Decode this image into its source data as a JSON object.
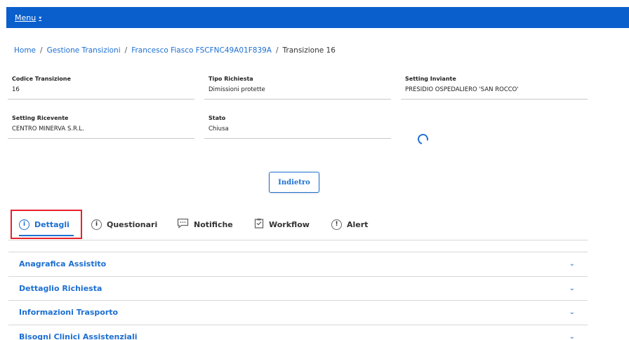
{
  "topbar": {
    "menu_label": "Menu",
    "caret": "▾"
  },
  "breadcrumb": {
    "items": [
      "Home",
      "Gestione Transizioni",
      "Francesco Fiasco FSCFNC49A01F839A"
    ],
    "current": "Transizione 16",
    "separator": "/"
  },
  "fields": {
    "codice_transizione": {
      "label": "Codice Transizione",
      "value": "16"
    },
    "tipo_richiesta": {
      "label": "Tipo Richiesta",
      "value": "Dimissioni protette"
    },
    "setting_inviante": {
      "label": "Setting Inviante",
      "value": "PRESIDIO OSPEDALIERO 'SAN ROCCO'"
    },
    "setting_ricevente": {
      "label": "Setting Ricevente",
      "value": "CENTRO MINERVA S.R.L."
    },
    "stato": {
      "label": "Stato",
      "value": "Chiusa"
    }
  },
  "back_button": {
    "label": "Indietro"
  },
  "tabs": [
    {
      "label": "Dettagli",
      "icon": "info-circle-icon",
      "active": true
    },
    {
      "label": "Questionari",
      "icon": "info-circle-icon",
      "active": false
    },
    {
      "label": "Notifiche",
      "icon": "chat-bubble-icon",
      "active": false
    },
    {
      "label": "Workflow",
      "icon": "clipboard-icon",
      "active": false
    },
    {
      "label": "Alert",
      "icon": "exclamation-circle-icon",
      "active": false
    }
  ],
  "accordion": [
    {
      "title": "Anagrafica Assistito"
    },
    {
      "title": "Dettaglio Richiesta"
    },
    {
      "title": "Informazioni Trasporto"
    },
    {
      "title": "Bisogni Clinici Assistenziali"
    }
  ],
  "colors": {
    "primary": "#1d6fd1",
    "topbar": "#0a5fcc",
    "highlight": "#e8202a"
  }
}
